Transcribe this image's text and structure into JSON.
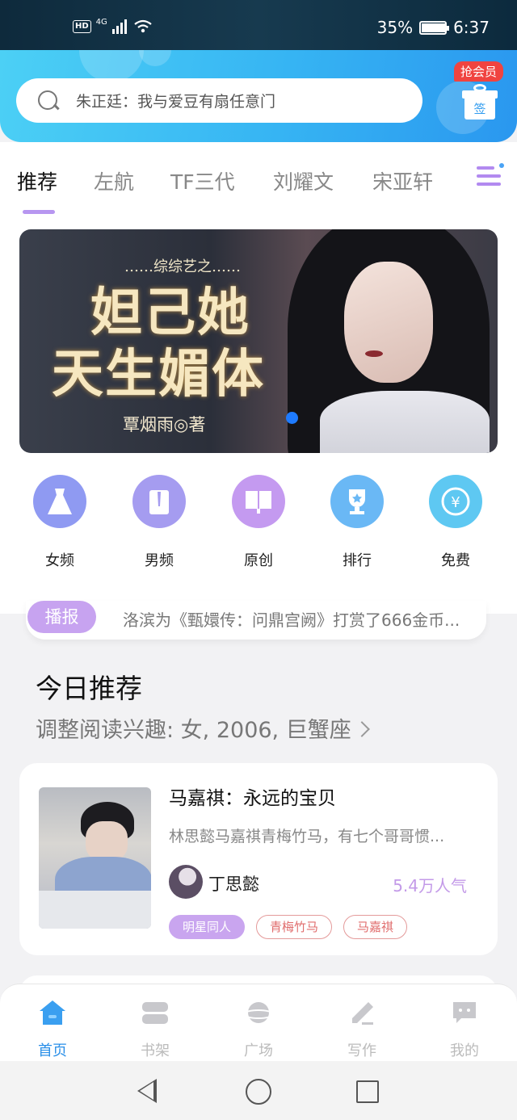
{
  "status_bar": {
    "network": "4G",
    "hd": "HD",
    "battery": "35%",
    "battery_level": 0.35,
    "time": "6:37"
  },
  "search": {
    "placeholder": "朱正廷：我与爱豆有扇任意门"
  },
  "vip": {
    "badge": "抢会员",
    "sign_label": "签"
  },
  "tabs": [
    {
      "label": "推荐",
      "active": true
    },
    {
      "label": "左航"
    },
    {
      "label": "TF三代"
    },
    {
      "label": "刘耀文"
    },
    {
      "label": "宋亚轩"
    }
  ],
  "banner": {
    "subtitle": "……综综艺之……",
    "title_line1": "妲己她",
    "title_line2": "天生媚体",
    "author": "覃烟雨◎著"
  },
  "categories": [
    {
      "label": "女频",
      "icon": "dress-icon",
      "color": "#8f9af2"
    },
    {
      "label": "男频",
      "icon": "shirt-icon",
      "color": "#a59cf0"
    },
    {
      "label": "原创",
      "icon": "book-icon",
      "color": "#c49af0"
    },
    {
      "label": "排行",
      "icon": "trophy-icon",
      "color": "#6ab8f5"
    },
    {
      "label": "免费",
      "icon": "yen-coin-icon",
      "color": "#5ec8f2"
    }
  ],
  "broadcast": {
    "tag": "播报",
    "text": "洛滨为《甄嬛传：问鼎宫阙》打赏了666金币..."
  },
  "today": {
    "title": "今日推荐",
    "interest": "调整阅读兴趣: 女, 2006, 巨蟹座"
  },
  "book": {
    "title": "马嘉祺：永远的宝贝",
    "description": "林思懿马嘉祺青梅竹马，有七个哥哥惯...",
    "author": "丁思懿",
    "popularity": "5.4万人气",
    "tags": [
      "明星同人",
      "青梅竹马",
      "马嘉祺"
    ]
  },
  "bottom_nav": [
    {
      "label": "首页",
      "icon": "home-icon",
      "active": true
    },
    {
      "label": "书架",
      "icon": "bookshelf-icon"
    },
    {
      "label": "广场",
      "icon": "planet-icon"
    },
    {
      "label": "写作",
      "icon": "pen-icon"
    },
    {
      "label": "我的",
      "icon": "chat-face-icon"
    }
  ],
  "colors": {
    "accent": "#2a8fe8",
    "purple": "#c9a5ef",
    "header_start": "#4cd0f5",
    "header_end": "#2a97ef"
  }
}
